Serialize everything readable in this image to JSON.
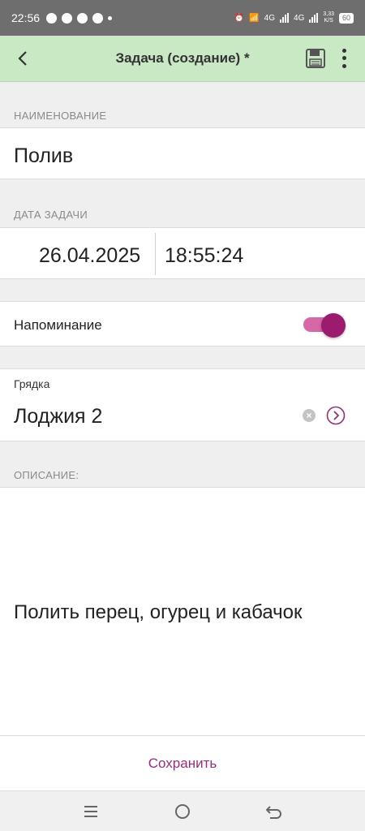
{
  "status_bar": {
    "time": "22:56",
    "network_label_1": "4G",
    "network_label_2": "4G",
    "speed_value": "3,33",
    "speed_unit": "K/S",
    "battery": "60"
  },
  "appbar": {
    "title": "Задача (создание) *",
    "back_icon": "arrow-left-icon",
    "save_icon": "floppy-disk-icon",
    "more_icon": "more-vertical-icon",
    "background_color": "#c9e8c4"
  },
  "name_section": {
    "label": "НАИМЕНОВАНИЕ",
    "value": "Полив"
  },
  "date_section": {
    "label": "ДАТА ЗАДАЧИ",
    "date": "26.04.2025",
    "time": "18:55:24"
  },
  "reminder": {
    "label": "Напоминание",
    "enabled": true,
    "accent_color": "#9c1b6e"
  },
  "bed": {
    "label": "Грядка",
    "value": "Лоджия 2",
    "clear_icon": "clear-circle-icon",
    "open_icon": "chevron-right-circle-icon"
  },
  "description": {
    "label": "ОПИСАНИЕ:",
    "value": "Полить перец, огурец и кабачок"
  },
  "footer": {
    "save_label": "Сохранить",
    "save_color": "#9c2b7c"
  },
  "nav_bar": {
    "icons": [
      "menu-icon",
      "home-circle-icon",
      "back-arrow-icon"
    ]
  }
}
